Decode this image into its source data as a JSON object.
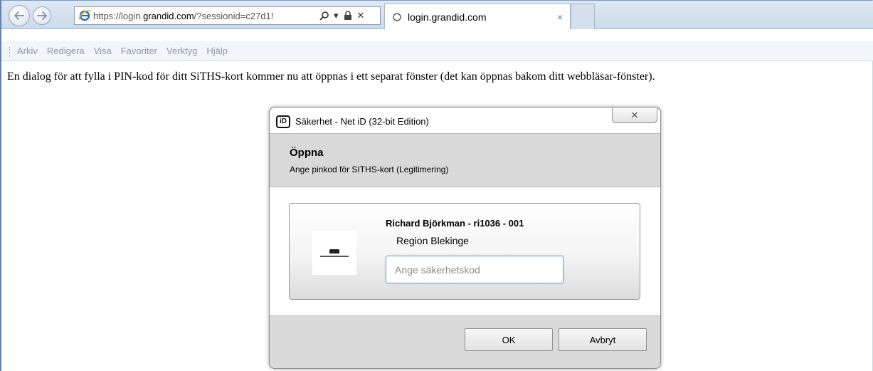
{
  "browser": {
    "url_prefix": "https://login.",
    "url_domain": "grandid.com",
    "url_suffix": "/?sessionid=c27d1!",
    "tab_title": "login.grandid.com",
    "tab_close": "×",
    "address_search_glyph": "⌕",
    "address_dropdown_glyph": "▾",
    "address_stop_glyph": "✕"
  },
  "menu": {
    "items": [
      "Arkiv",
      "Redigera",
      "Visa",
      "Favoriter",
      "Verktyg",
      "Hjälp"
    ]
  },
  "page": {
    "message": "En dialog för att fylla i PIN-kod för ditt SiTHS-kort kommer nu att öppnas i ett separat fönster (det kan öppnas bakom ditt webbläsar-fönster)."
  },
  "dialog": {
    "logo_text": "iD",
    "title": "Säkerhet - Net iD (32-bit Edition)",
    "close_glyph": "✕",
    "header_title": "Öppna",
    "header_subtitle": "Ange pinkod för SITHS-kort (Legitimering)",
    "card_holder": "Richard Björkman - ri1036 - 001",
    "card_org": "Region Blekinge",
    "pin_placeholder": "Ange säkerhetskod",
    "pin_value": "",
    "ok_label": "OK",
    "cancel_label": "Avbryt"
  },
  "colors": {
    "window_border": "#5b84b0",
    "input_focus_border": "#6f9edb",
    "ie_blue": "#1e6fd3"
  }
}
